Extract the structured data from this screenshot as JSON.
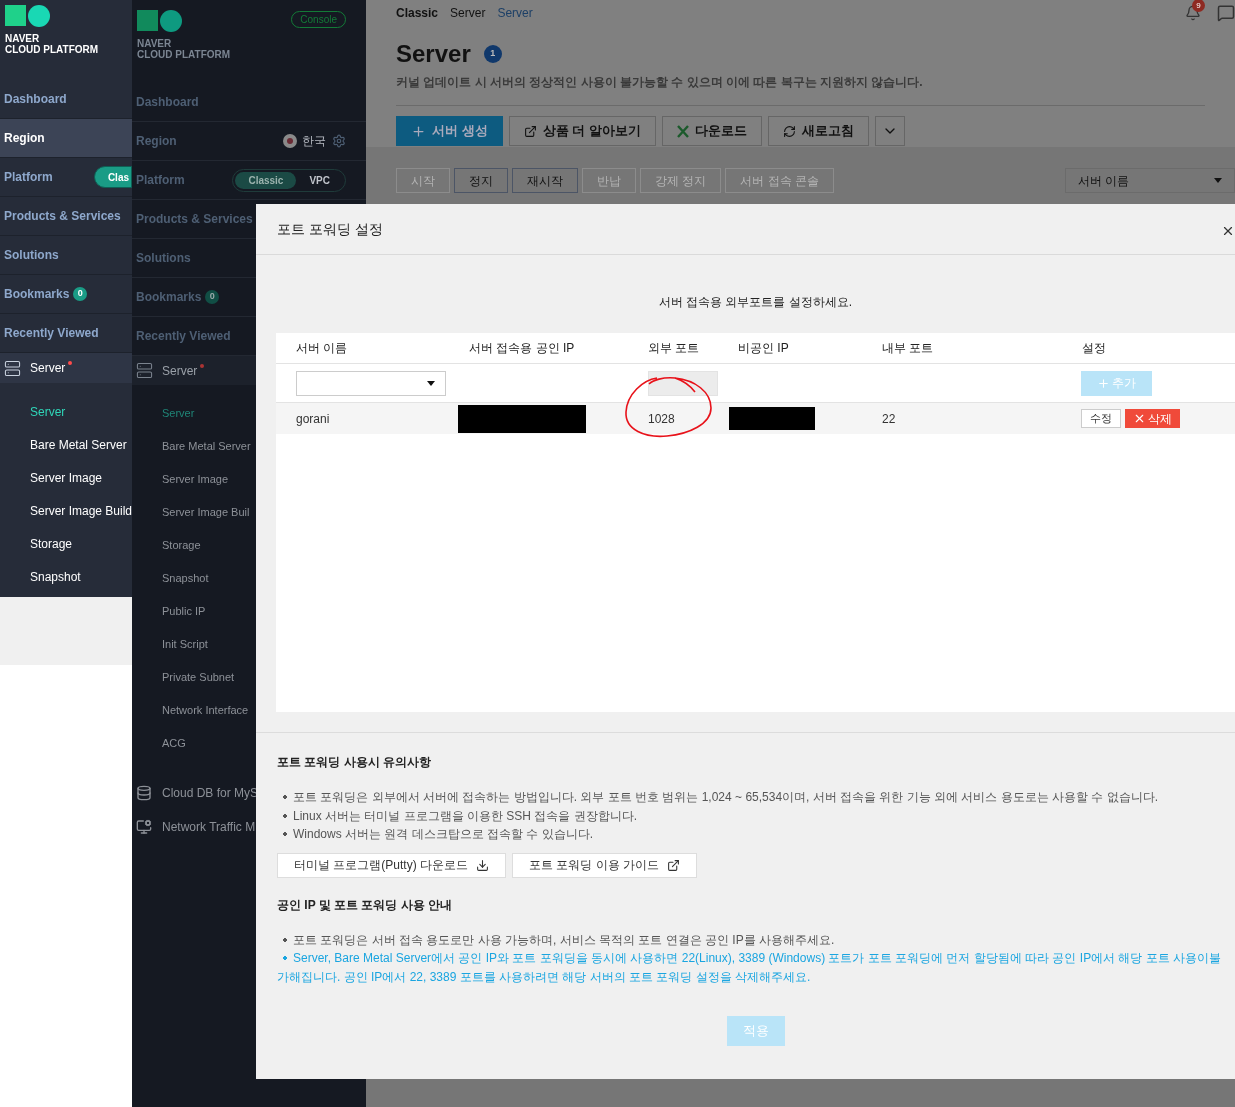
{
  "front_sidebar": {
    "brand": [
      "NAVER",
      "CLOUD PLATFORM"
    ],
    "menu": [
      {
        "kind": "plain",
        "label": "Dashboard",
        "selected": false
      },
      {
        "kind": "plain",
        "label": "Region",
        "selected": true
      },
      {
        "kind": "toggle",
        "label": "Platform",
        "selected": false,
        "toggle": "Clas"
      },
      {
        "kind": "plain",
        "label": "Products & Services",
        "selected": false
      },
      {
        "kind": "plain",
        "label": "Solutions",
        "selected": false
      },
      {
        "kind": "badge",
        "label": "Bookmarks",
        "selected": false,
        "badge": "0"
      },
      {
        "kind": "plain",
        "label": "Recently Viewed",
        "selected": false
      }
    ],
    "group": {
      "label": "Server",
      "new_dot": true,
      "children": [
        {
          "label": "Server",
          "selected": true
        },
        {
          "label": "Bare Metal Server",
          "selected": false
        },
        {
          "label": "Server Image",
          "selected": false
        },
        {
          "label": "Server Image Build",
          "selected": false
        },
        {
          "label": "Storage",
          "selected": false
        },
        {
          "label": "Snapshot",
          "selected": false
        }
      ]
    }
  },
  "back_sidebar": {
    "brand": [
      "NAVER",
      "CLOUD PLATFORM"
    ],
    "console": "Console",
    "menu": [
      {
        "kind": "plain",
        "label": "Dashboard"
      },
      {
        "kind": "region",
        "label": "Region",
        "region": "한국"
      },
      {
        "kind": "platform",
        "label": "Platform",
        "options": [
          {
            "label": "Classic",
            "selected": true
          },
          {
            "label": "VPC",
            "selected": false
          }
        ]
      },
      {
        "kind": "plain",
        "label": "Products & Services"
      },
      {
        "kind": "plain",
        "label": "Solutions"
      },
      {
        "kind": "badge",
        "label": "Bookmarks",
        "badge": "0"
      },
      {
        "kind": "plain",
        "label": "Recently Viewed"
      }
    ],
    "group": {
      "label": "Server",
      "new_dot": true,
      "children": [
        {
          "label": "Server",
          "selected": true
        },
        {
          "label": "Bare Metal Server",
          "selected": false
        },
        {
          "label": "Server Image",
          "selected": false
        },
        {
          "label": "Server Image Buil",
          "selected": false
        },
        {
          "label": "Storage",
          "selected": false
        },
        {
          "label": "Snapshot",
          "selected": false
        },
        {
          "label": "Public IP",
          "selected": false
        },
        {
          "label": "Init Script",
          "selected": false
        },
        {
          "label": "Private Subnet",
          "selected": false
        },
        {
          "label": "Network Interface",
          "selected": false
        },
        {
          "label": "ACG",
          "selected": false
        }
      ]
    },
    "other_groups": [
      {
        "kind": "database",
        "label": "Cloud DB for MyS"
      },
      {
        "kind": "monitor",
        "label": "Network Traffic M"
      }
    ]
  },
  "page": {
    "breadcrumb": [
      "Classic",
      "Server",
      "Server"
    ],
    "notifications": "9",
    "title": "Server",
    "count": "1",
    "notice": "커널 업데이트 시 서버의 정상적인 사용이 불가능할 수 있으며 이에 따른 복구는 지원하지 않습니다.",
    "toolbar": [
      {
        "kind": "primary",
        "label": "서버 생성"
      },
      {
        "kind": "default",
        "label": "상품 더 알아보기"
      },
      {
        "kind": "default",
        "label": "다운로드"
      },
      {
        "kind": "default",
        "label": "새로고침"
      },
      {
        "kind": "more"
      }
    ],
    "actions": [
      {
        "label": "시작",
        "disabled": true
      },
      {
        "label": "정지",
        "disabled": false
      },
      {
        "label": "재시작",
        "disabled": false
      },
      {
        "label": "반납",
        "disabled": true
      },
      {
        "label": "강제 정지",
        "disabled": true
      },
      {
        "label": "서버 접속 콘솔",
        "disabled": true
      }
    ],
    "search_select": "서버 이름"
  },
  "modal": {
    "title": "포트 포워딩 설정",
    "instruction": "서버 접속용 외부포트를 설정하세요.",
    "columns": [
      "서버 이름",
      "서버 접속용 공인 IP",
      "외부 포트",
      "비공인 IP",
      "내부 포트",
      "설정"
    ],
    "add_button": {
      "label": "추가",
      "disabled": true
    },
    "rows": [
      {
        "server": "gorani",
        "public_ip_redacted": true,
        "external_port": "1028",
        "private_ip_redacted": true,
        "internal_port": "22",
        "edit": "수정",
        "delete": "삭제"
      }
    ],
    "notes": [
      {
        "heading": "포트 포워딩 사용시 유의사항",
        "bullets": [
          {
            "text": "포트 포워딩은 외부에서 서버에 접속하는 방법입니다. 외부 포트 번호 범위는 1,024 ~ 65,534이며, 서버 접속을 위한 기능 외에 서비스 용도로는 사용할 수 없습니다.",
            "highlight": false
          },
          {
            "text": "Linux 서버는 터미널 프로그램을 이용한 SSH 접속을 권장합니다.",
            "highlight": false
          },
          {
            "text": "Windows 서버는 원격 데스크탑으로 접속할 수 있습니다.",
            "highlight": false
          }
        ],
        "buttons": [
          {
            "label": "터미널 프로그램(Putty) 다운로드"
          },
          {
            "label": "포트 포워딩 이용 가이드"
          }
        ]
      },
      {
        "heading": "공인 IP 및 포트 포워딩 사용 안내",
        "bullets": [
          {
            "text": "포트 포워딩은 서버 접속 용도로만 사용 가능하며, 서비스 목적의 포트 연결은 공인 IP를 사용해주세요.",
            "highlight": false
          },
          {
            "text": "Server, Bare Metal Server에서 공인 IP와 포트 포워딩을 동시에 사용하면 22(Linux), 3389 (Windows) 포트가 포트 포워딩에 먼저 할당됨에 따라 공인 IP에서 해당 포트 사용이불가해집니다. 공인 IP에서 22, 3389 포트를 사용하려면 해당 서버의 포트 포워딩 설정을 삭제해주세요.",
            "highlight": true
          }
        ]
      }
    ],
    "apply": {
      "label": "적용",
      "disabled": true
    }
  }
}
